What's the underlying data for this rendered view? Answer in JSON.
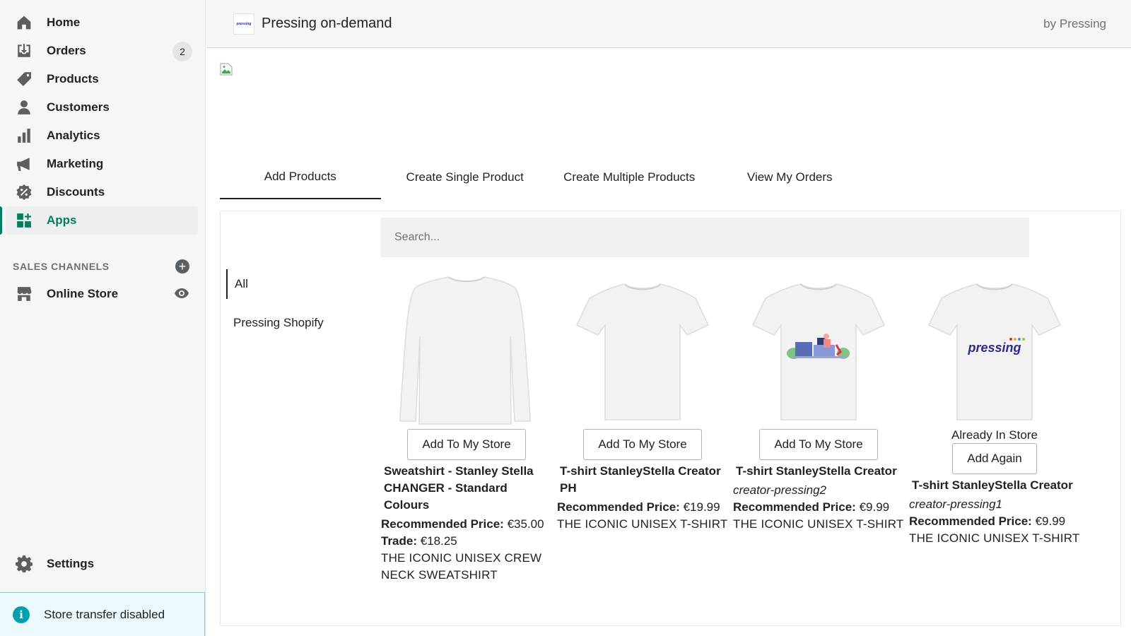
{
  "sidebar": {
    "items": [
      {
        "label": "Home",
        "icon": "home-icon"
      },
      {
        "label": "Orders",
        "icon": "orders-icon",
        "badge": "2"
      },
      {
        "label": "Products",
        "icon": "tag-icon"
      },
      {
        "label": "Customers",
        "icon": "person-icon"
      },
      {
        "label": "Analytics",
        "icon": "bar-chart-icon"
      },
      {
        "label": "Marketing",
        "icon": "megaphone-icon"
      },
      {
        "label": "Discounts",
        "icon": "discount-icon"
      },
      {
        "label": "Apps",
        "icon": "apps-icon",
        "active": true
      }
    ],
    "sales_channels_title": "SALES CHANNELS",
    "online_store_label": "Online Store",
    "settings_label": "Settings",
    "transfer_notice": "Store transfer disabled"
  },
  "header": {
    "logo_text": "pressing",
    "app_name": "Pressing on-demand",
    "by_label": "by Pressing"
  },
  "tabs": [
    {
      "label": "Add Products",
      "active": true
    },
    {
      "label": "Create Single Product"
    },
    {
      "label": "Create Multiple Products"
    },
    {
      "label": "View My Orders"
    }
  ],
  "search": {
    "placeholder": "Search..."
  },
  "categories": [
    {
      "label": "All",
      "active": true
    },
    {
      "label": "Pressing Shopify"
    }
  ],
  "products": [
    {
      "image": "sweatshirt",
      "button": "Add To My Store",
      "name": "Sweatshirt - Stanley Stella CHANGER - Standard Colours",
      "price_label": "Recommended Price:",
      "price": "€35.00",
      "trade_label": "Trade:",
      "trade": "€18.25",
      "description": "THE ICONIC UNISEX CREW NECK SWEATSHIRT"
    },
    {
      "image": "tshirt-plain",
      "button": "Add To My Store",
      "name": "T-shirt StanleyStella Creator PH",
      "price_label": "Recommended Price:",
      "price": "€19.99",
      "description": "THE ICONIC UNISEX T-SHIRT"
    },
    {
      "image": "tshirt-illustration",
      "button": "Add To My Store",
      "name": "T-shirt StanleyStella Creator",
      "sku": "creator-pressing2",
      "price_label": "Recommended Price:",
      "price": "€9.99",
      "description": "THE ICONIC UNISEX T-SHIRT"
    },
    {
      "image": "tshirt-pressing-logo",
      "print_text": "pressing",
      "status": "Already In Store",
      "button": "Add Again",
      "name": "T-shirt StanleyStella Creator",
      "sku": "creator-pressing1",
      "price_label": "Recommended Price:",
      "price": "€9.99",
      "description": "THE ICONIC UNISEX T-SHIRT"
    }
  ],
  "colors": {
    "accent": "#008060",
    "sidebar_bg": "#f6f6f7",
    "info": "#00a0ac"
  }
}
